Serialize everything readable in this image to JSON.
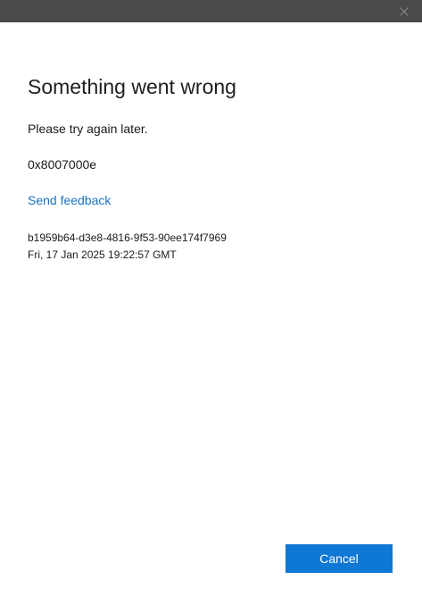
{
  "titlebar": {
    "close_icon": "close-icon",
    "background_color": "#4a4a4a"
  },
  "dialog": {
    "heading": "Something went wrong",
    "message": "Please try again later.",
    "error_code": "0x8007000e",
    "feedback_link": "Send feedback",
    "correlation_id": "b1959b64-d3e8-4816-9f53-90ee174f7969",
    "timestamp": "Fri, 17 Jan 2025 19:22:57 GMT"
  },
  "buttons": {
    "cancel_label": "Cancel"
  },
  "colors": {
    "accent": "#0f78d4",
    "link": "#1a73c2"
  }
}
